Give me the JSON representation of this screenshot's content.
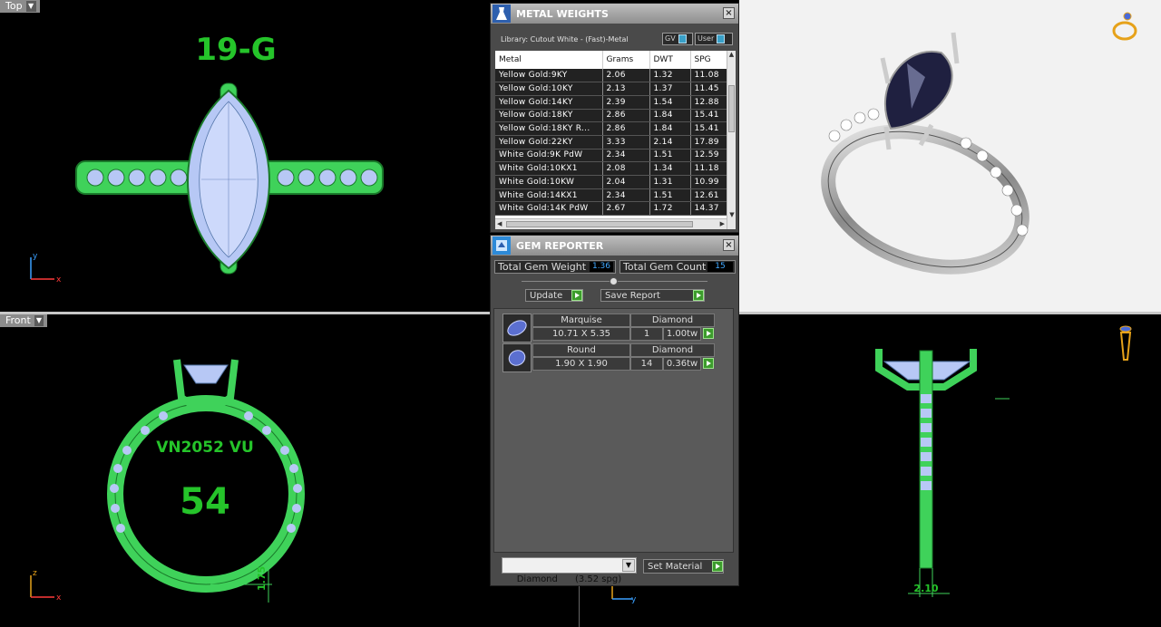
{
  "viewports": {
    "top": {
      "label": "Top",
      "title_text": "19-G"
    },
    "front": {
      "label": "Front",
      "inner_text": "VN2052 VU",
      "size_text": "54",
      "dim_text": "1.75"
    },
    "side": {
      "dim_text": "2.10"
    }
  },
  "axes": {
    "x": "x",
    "y": "y",
    "z": "z"
  },
  "metal_weights": {
    "title": "METAL WEIGHTS",
    "library": "Library: Cutout White - (Fast)-Metal",
    "gv_label": "GV",
    "user_label": "User",
    "columns": [
      "Metal",
      "Grams",
      "DWT",
      "SPG"
    ],
    "rows": [
      [
        "Yellow Gold:9KY",
        "2.06",
        "1.32",
        "11.08"
      ],
      [
        "Yellow Gold:10KY",
        "2.13",
        "1.37",
        "11.45"
      ],
      [
        "Yellow Gold:14KY",
        "2.39",
        "1.54",
        "12.88"
      ],
      [
        "Yellow Gold:18KY",
        "2.86",
        "1.84",
        "15.41"
      ],
      [
        "Yellow Gold:18KY R...",
        "2.86",
        "1.84",
        "15.41"
      ],
      [
        "Yellow Gold:22KY",
        "3.33",
        "2.14",
        "17.89"
      ],
      [
        "White Gold:9K PdW",
        "2.34",
        "1.51",
        "12.59"
      ],
      [
        "White Gold:10KX1",
        "2.08",
        "1.34",
        "11.18"
      ],
      [
        "White Gold:10KW",
        "2.04",
        "1.31",
        "10.99"
      ],
      [
        "White Gold:14KX1",
        "2.34",
        "1.51",
        "12.61"
      ],
      [
        "White Gold:14K PdW",
        "2.67",
        "1.72",
        "14.37"
      ]
    ]
  },
  "gem_reporter": {
    "title": "GEM REPORTER",
    "total_weight_label": "Total Gem Weight",
    "total_weight_value": "1.36",
    "total_count_label": "Total Gem Count",
    "total_count_value": "15",
    "update_label": "Update",
    "save_label": "Save Report",
    "gems": [
      {
        "shape": "Marquise",
        "material": "Diamond",
        "size": "10.71 X 5.35",
        "count": "1",
        "weight": "1.00tw"
      },
      {
        "shape": "Round",
        "material": "Diamond",
        "size": "1.90 X 1.90",
        "count": "14",
        "weight": "0.36tw"
      }
    ],
    "material_select": "Diamond      (3.52 spg)",
    "set_material_label": "Set Material"
  },
  "colors": {
    "model_green": "#3fd25a",
    "gem_blue": "#b7c8f5",
    "panel_bg": "#4a4a4a"
  }
}
